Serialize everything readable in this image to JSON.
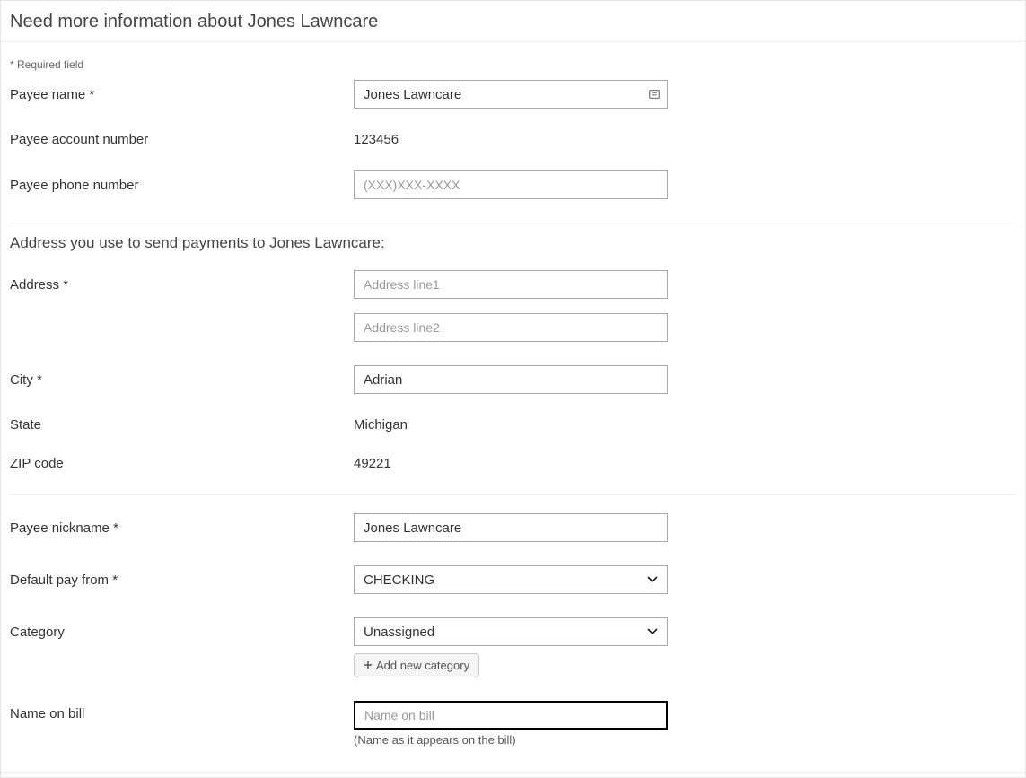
{
  "header": {
    "title": "Need more information about Jones Lawncare"
  },
  "required_note": "* Required field",
  "fields": {
    "payee_name": {
      "label": "Payee name *",
      "value": "Jones Lawncare"
    },
    "account_number": {
      "label": "Payee account number",
      "value": "123456"
    },
    "phone": {
      "label": "Payee phone number",
      "placeholder": "(XXX)XXX-XXXX",
      "value": ""
    }
  },
  "address_section": {
    "heading": "Address you use to send payments to Jones Lawncare:",
    "address": {
      "label": "Address *",
      "line1_placeholder": "Address line1",
      "line1_value": "",
      "line2_placeholder": "Address line2",
      "line2_value": ""
    },
    "city": {
      "label": "City *",
      "value": "Adrian"
    },
    "state": {
      "label": "State",
      "value": "Michigan"
    },
    "zip": {
      "label": "ZIP code",
      "value": "49221"
    }
  },
  "bottom": {
    "nickname": {
      "label": "Payee nickname *",
      "value": "Jones Lawncare"
    },
    "default_pay": {
      "label": "Default pay from *",
      "value": "CHECKING"
    },
    "category": {
      "label": "Category",
      "value": "Unassigned",
      "add_button": "Add new category"
    },
    "name_on_bill": {
      "label": "Name on bill",
      "placeholder": "Name on bill",
      "value": "",
      "helper": "(Name as it appears on the bill)"
    }
  }
}
